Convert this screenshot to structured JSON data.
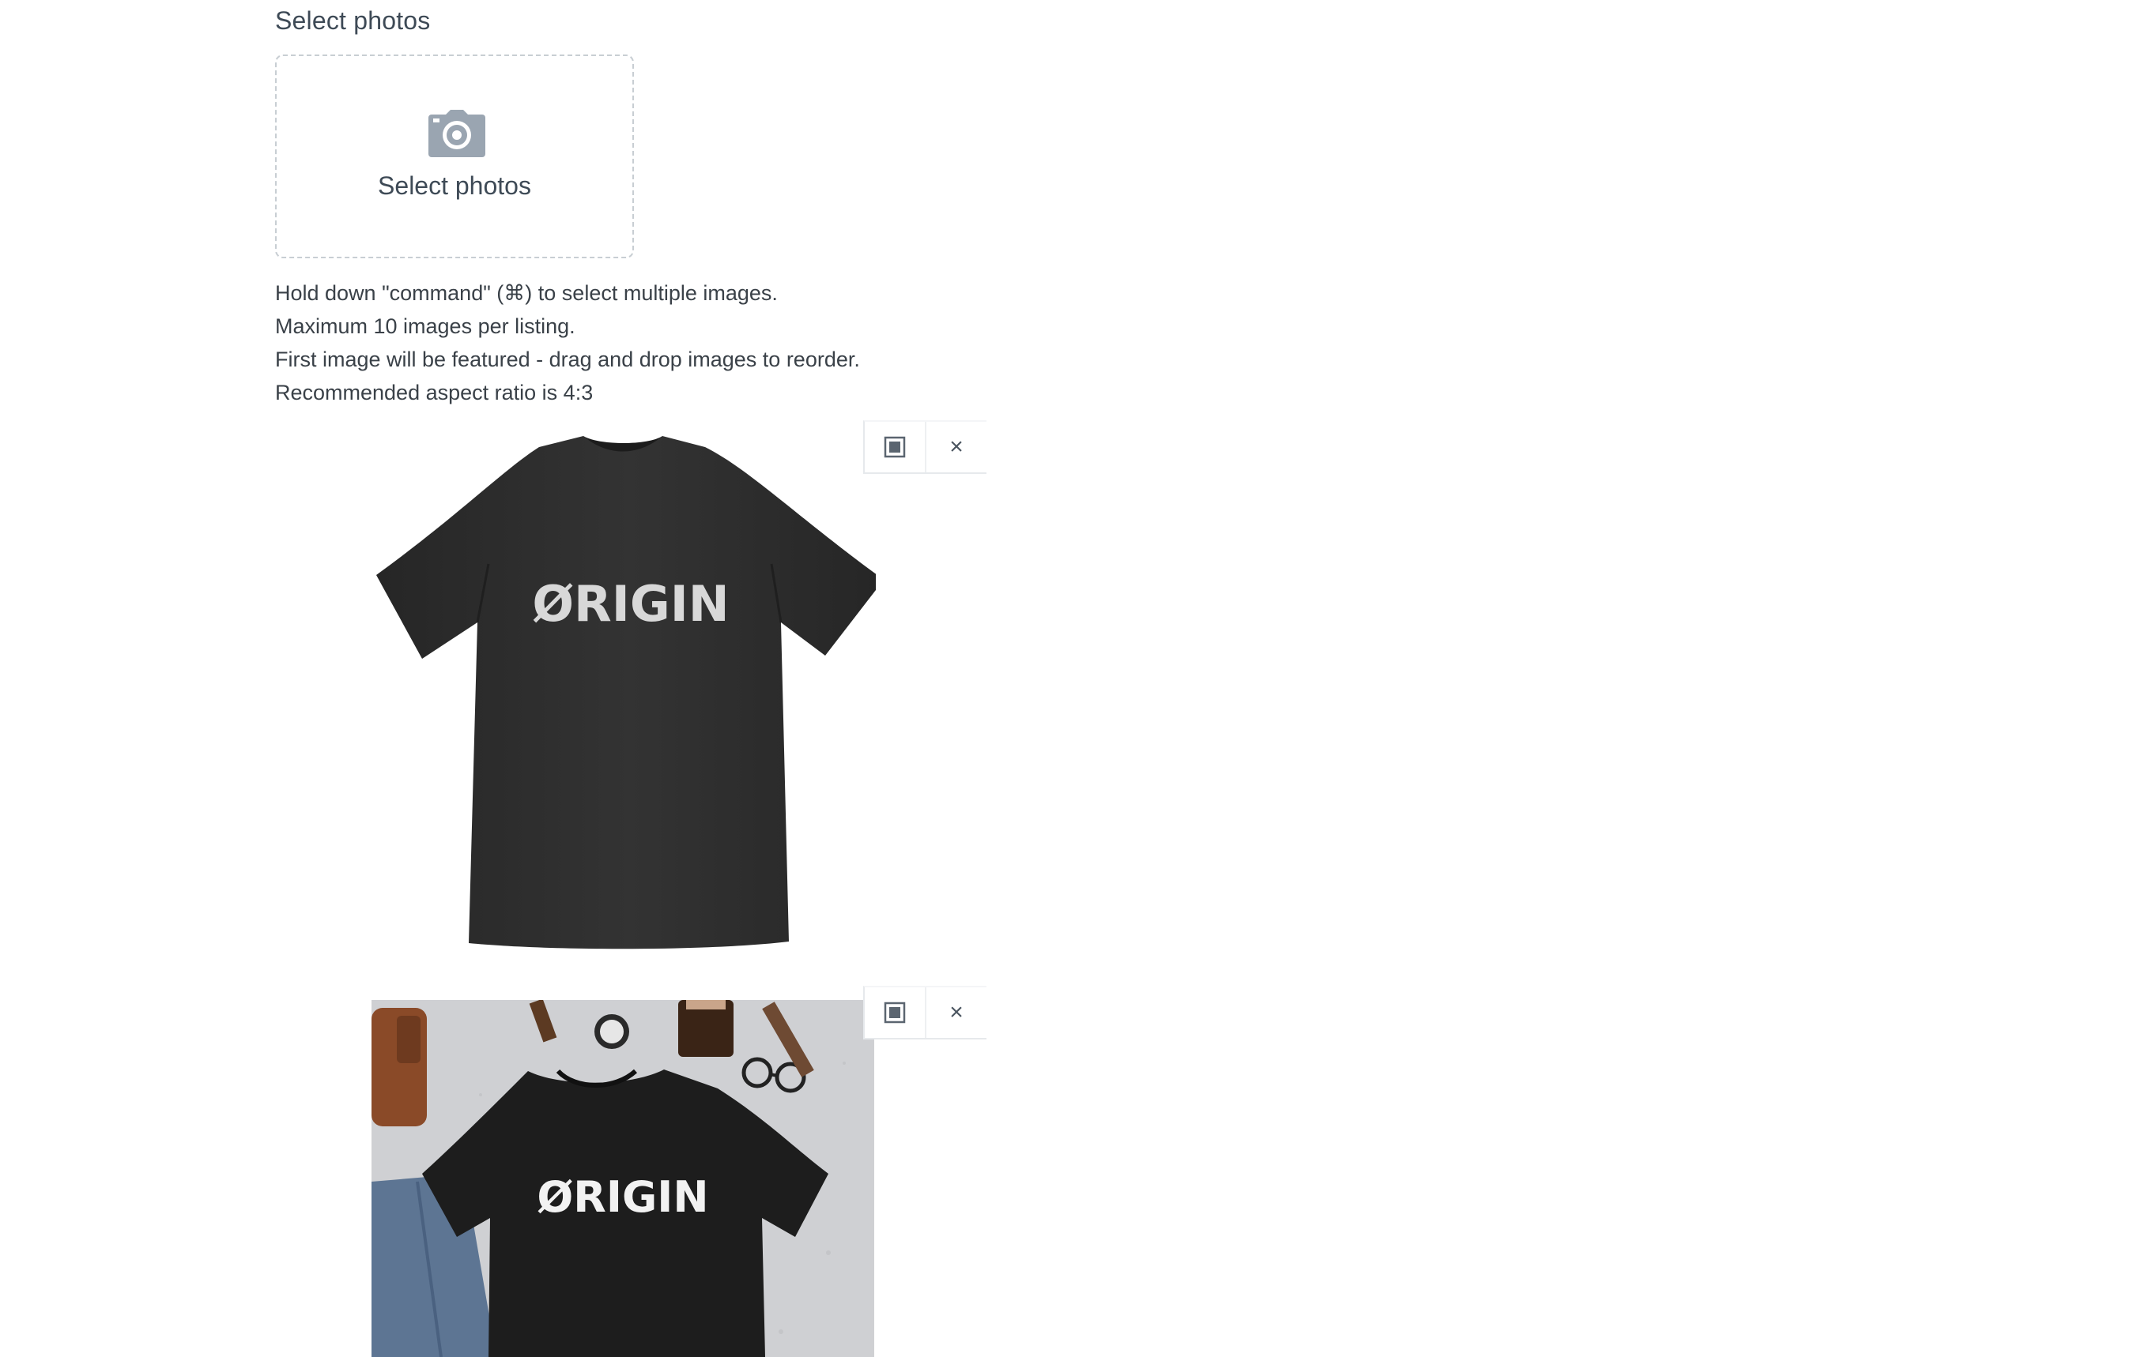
{
  "section_label": "Select photos",
  "dropzone": {
    "icon": "camera-icon",
    "label": "Select photos"
  },
  "help_lines": [
    "Hold down \"command\" (⌘) to select multiple images.",
    "Maximum 10 images per listing.",
    "First image will be featured - drag and drop images to reorder.",
    "Recommended aspect ratio is 4:3"
  ],
  "photos": [
    {
      "shirt_print": "ØRIGIN",
      "controls": {
        "crop_icon": "crop-icon",
        "remove_icon": "close-icon",
        "remove_label": "×"
      }
    },
    {
      "shirt_print": "ØRIGIN",
      "controls": {
        "crop_icon": "crop-icon",
        "remove_icon": "close-icon",
        "remove_label": "×"
      }
    }
  ],
  "colors": {
    "text": "#3a4148",
    "dashed_border": "#c8ced3",
    "camera_icon": "#9aa5b1",
    "shirt": "#2b2b2b",
    "background_concrete": "#cfd0d3"
  }
}
